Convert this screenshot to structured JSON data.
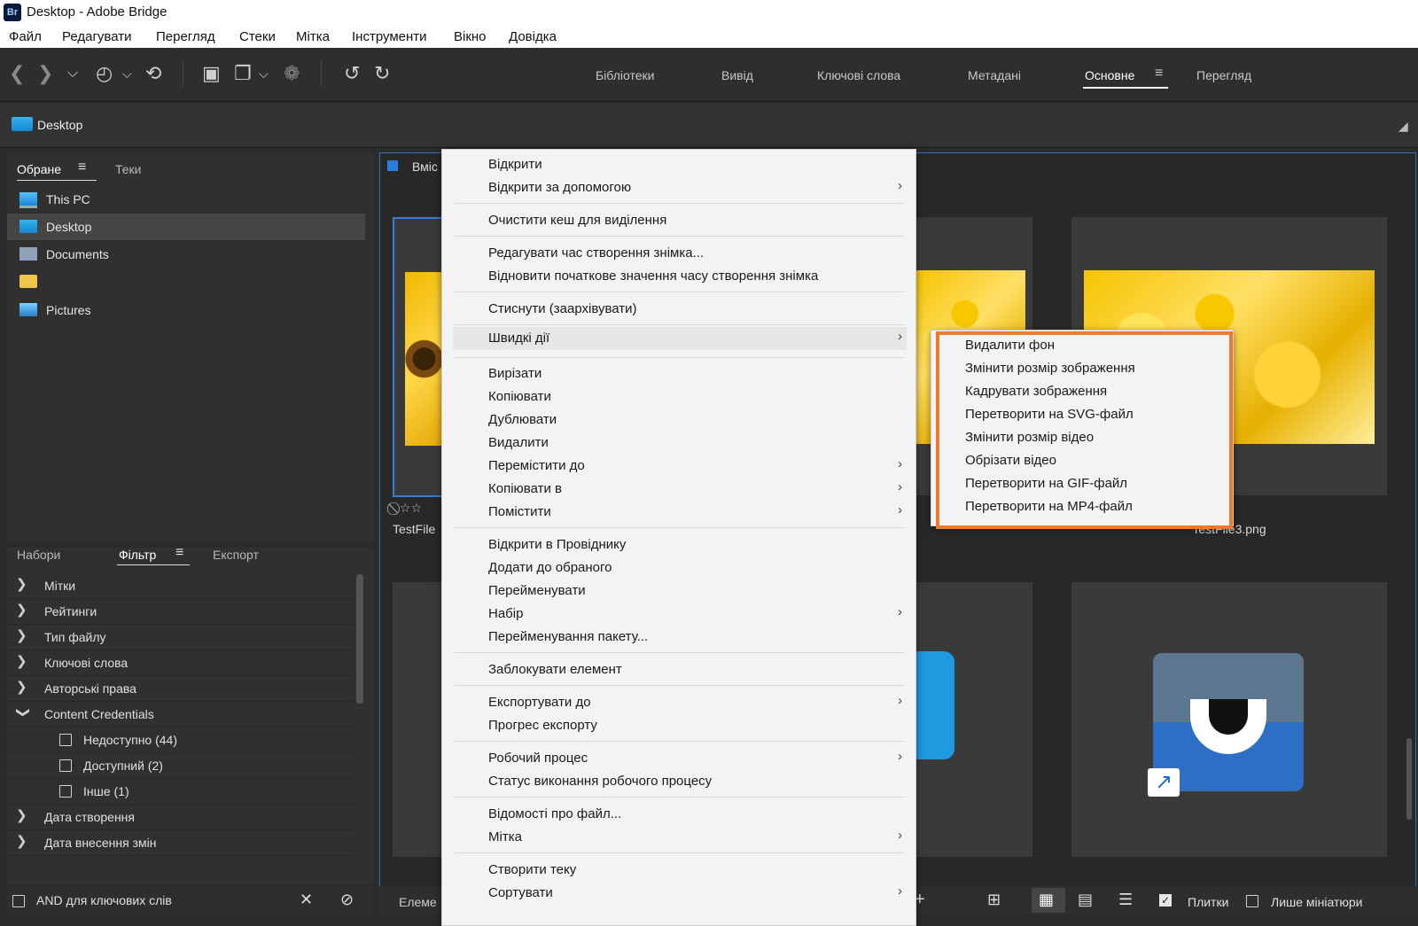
{
  "window": {
    "app_icon": "Br",
    "title": "Desktop - Adobe Bridge"
  },
  "menubar": [
    "Файл",
    "Редагувати",
    "Перегляд",
    "Стеки",
    "Мітка",
    "Інструменти",
    "Вікно",
    "Довідка"
  ],
  "workspaces": [
    "Бібліотеки",
    "Вивід",
    "Ключові слова",
    "Метадані",
    "Основне",
    "Перегляд"
  ],
  "workspace_active": "Основне",
  "path": {
    "current": "Desktop"
  },
  "favorites_panel": {
    "tabs": [
      "Обране",
      "Теки"
    ],
    "items": [
      {
        "label": "This PC",
        "icon": "monitor-icon"
      },
      {
        "label": "Desktop",
        "icon": "desktop-icon",
        "selected": true
      },
      {
        "label": "Documents",
        "icon": "documents-icon"
      },
      {
        "label": "",
        "icon": "folder-icon"
      },
      {
        "label": "Pictures",
        "icon": "pictures-icon"
      }
    ]
  },
  "filter_panel": {
    "tabs": [
      "Набори",
      "Фільтр",
      "Експорт"
    ],
    "rows": [
      {
        "label": "Мітки"
      },
      {
        "label": "Рейтинги"
      },
      {
        "label": "Тип файлу"
      },
      {
        "label": "Ключові слова"
      },
      {
        "label": "Авторські права"
      },
      {
        "label": "Content Credentials",
        "expanded": true
      }
    ],
    "credentials_options": [
      {
        "label": "Недоступно",
        "count": "(44)"
      },
      {
        "label": "Доступний",
        "count": "(2)"
      },
      {
        "label": "Інше",
        "count": "(1)"
      }
    ],
    "rows_after": [
      {
        "label": "Дата створення"
      },
      {
        "label": "Дата внесення змін"
      }
    ],
    "footer_label": "AND для ключових слів"
  },
  "content": {
    "header_label": "Вміс",
    "thumbnails": [
      {
        "caption": "TestFile",
        "rating_stars": 2
      },
      {
        "caption": "TestFile3.png"
      }
    ],
    "footer_label": "Елеме",
    "view_options": {
      "tiles": "Плитки",
      "thumbs_only": "Лише мініатюри",
      "tiles_checked": true,
      "thumbs_only_checked": false
    }
  },
  "context_menu": {
    "groups": [
      [
        {
          "label": "Відкрити"
        },
        {
          "label": "Відкрити за допомогою",
          "submenu": true
        }
      ],
      [
        {
          "label": "Очистити кеш для виділення"
        }
      ],
      [
        {
          "label": "Редагувати час створення знімка..."
        },
        {
          "label": "Відновити початкове значення часу створення знімка"
        }
      ],
      [
        {
          "label": "Стиснути (заархівувати)"
        }
      ],
      [
        {
          "label": "Швидкі дії",
          "submenu": true,
          "highlighted": true
        }
      ],
      [
        {
          "label": "Вирізати"
        },
        {
          "label": "Копіювати"
        },
        {
          "label": "Дублювати"
        },
        {
          "label": "Видалити"
        },
        {
          "label": "Перемістити до",
          "submenu": true
        },
        {
          "label": "Копіювати в",
          "submenu": true
        },
        {
          "label": "Помістити",
          "submenu": true
        }
      ],
      [
        {
          "label": "Відкрити в Провіднику"
        },
        {
          "label": "Додати до обраного"
        },
        {
          "label": "Перейменувати"
        },
        {
          "label": "Набір",
          "submenu": true
        },
        {
          "label": "Перейменування пакету..."
        }
      ],
      [
        {
          "label": "Заблокувати елемент"
        }
      ],
      [
        {
          "label": "Експортувати до",
          "submenu": true
        },
        {
          "label": "Прогрес експорту"
        }
      ],
      [
        {
          "label": "Робочий процес",
          "submenu": true
        },
        {
          "label": "Статус виконання робочого процесу"
        }
      ],
      [
        {
          "label": "Відомості про файл..."
        },
        {
          "label": "Мітка",
          "submenu": true
        }
      ],
      [
        {
          "label": "Створити теку"
        },
        {
          "label": "Сортувати",
          "submenu": true
        }
      ]
    ]
  },
  "quick_actions_submenu": {
    "items": [
      "Видалити фон",
      "Змінити розмір зображення",
      "Кадрувати зображення",
      "Перетворити на SVG-файл",
      "Змінити розмір відео",
      "Обрізати відео",
      "Перетворити на GIF-файл",
      "Перетворити на MP4-файл"
    ],
    "highlight_color": "#ef7a2c"
  },
  "colors": {
    "accent": "#3b7ad6",
    "panel": "#303030",
    "menu_bg": "#f3f3f3"
  }
}
